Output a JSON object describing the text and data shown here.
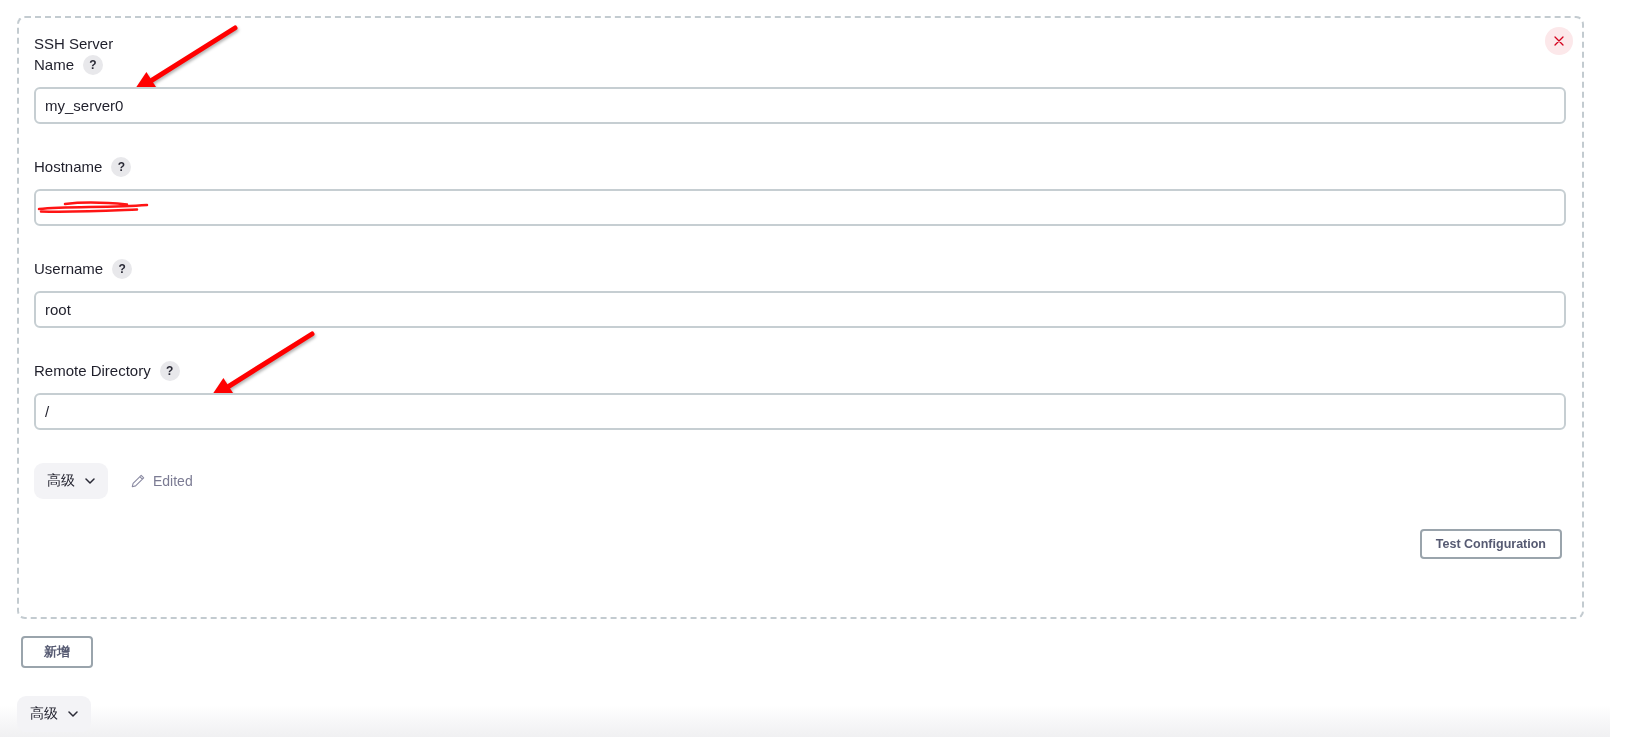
{
  "card": {
    "title": "SSH Server",
    "closable": true,
    "fields": [
      {
        "label": "Name",
        "help": "?",
        "value": "my_server0",
        "redacted": false,
        "arrow_annotation": true
      },
      {
        "label": "Hostname",
        "help": "?",
        "redacted": true,
        "arrow_annotation": false
      },
      {
        "label": "Username",
        "help": "?",
        "value": "root",
        "redacted": false,
        "arrow_annotation": false
      },
      {
        "label": "Remote Directory",
        "help": "?",
        "value": "/",
        "redacted": false,
        "arrow_annotation": true
      }
    ],
    "advanced_button": {
      "label": "高级",
      "expanded": false
    },
    "edited_status": {
      "label": "Edited"
    },
    "test_button": {
      "label": "Test Configuration"
    }
  },
  "add_button": {
    "label": "新增"
  },
  "footer": {
    "advanced_button": {
      "label": "高级",
      "expanded": false
    }
  }
}
